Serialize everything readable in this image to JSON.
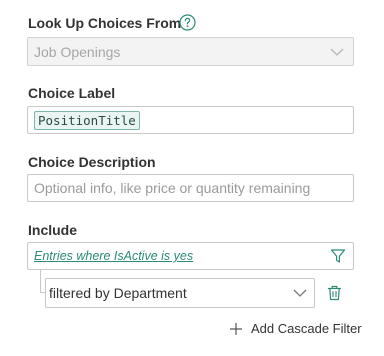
{
  "lookup": {
    "label": "Look Up Choices From",
    "selected": "Job Openings"
  },
  "choice_label": {
    "label": "Choice Label",
    "token": "PositionTitle"
  },
  "choice_description": {
    "label": "Choice Description",
    "placeholder": "Optional info, like price or quantity remaining"
  },
  "include": {
    "label": "Include",
    "filter_link": "Entries where IsActive is yes",
    "cascade_selected": "filtered by Department"
  },
  "actions": {
    "add_cascade_filter": "Add Cascade Filter"
  },
  "colors": {
    "accent": "#2a8a79",
    "chip_border": "#7cb7ac",
    "border": "#c8c8c8"
  },
  "icons": {
    "help": "question-circle-icon",
    "dropdown": "chevron-down-icon",
    "filter": "filter-funnel-icon",
    "delete": "trash-icon",
    "add": "plus-icon"
  }
}
